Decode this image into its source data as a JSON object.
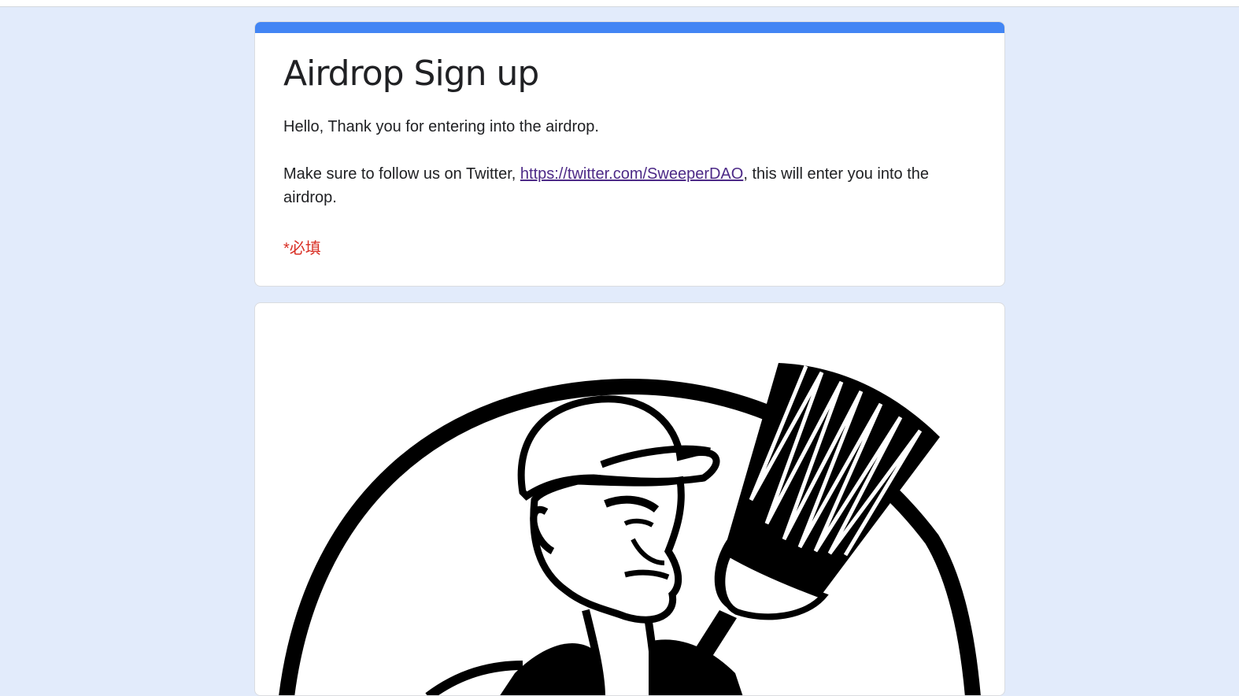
{
  "form": {
    "title": "Airdrop Sign up",
    "description_line1": "Hello, Thank you for entering into the airdrop.",
    "description_line2_prefix": "Make sure to follow us on Twitter, ",
    "twitter_link_text": "https://twitter.com/SweeperDAO",
    "description_line2_suffix": ", this will enter you into the airdrop.",
    "required_note": "*必填"
  },
  "colors": {
    "accent": "#4285f4",
    "page_background": "#e2ebfb",
    "required": "#d93025",
    "link": "#4d2a87"
  },
  "image": {
    "icon": "sweeper-mascot-icon"
  }
}
